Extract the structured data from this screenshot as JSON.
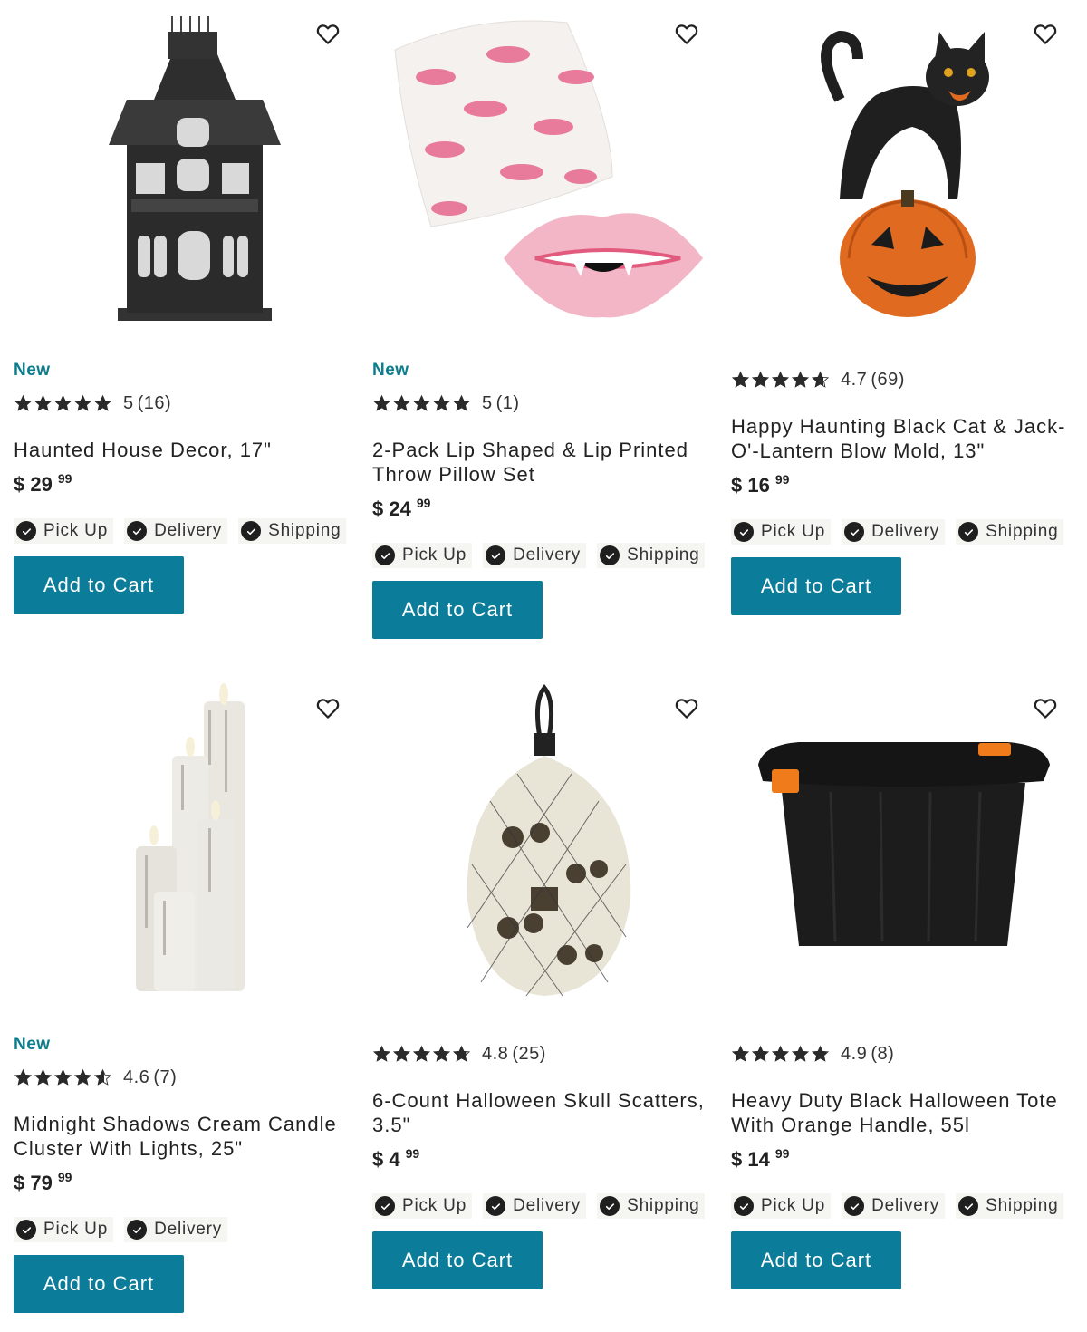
{
  "fulfillment_labels": {
    "pickup": "Pick Up",
    "delivery": "Delivery",
    "shipping": "Shipping"
  },
  "add_to_cart_label": "Add to Cart",
  "accent_colors": {
    "badge": "#0b7d8c",
    "button": "#0b7c99"
  },
  "products": [
    {
      "badge": "New",
      "rating": "5",
      "reviews": "(16)",
      "title": "Haunted House Decor, 17\"",
      "price_dollars": "$ 29",
      "price_cents": "99",
      "stars": 5,
      "fulfillment": [
        "pickup",
        "delivery",
        "shipping"
      ],
      "image": "haunted-house-image"
    },
    {
      "badge": "New",
      "rating": "5",
      "reviews": "(1)",
      "title": "2-Pack Lip Shaped & Lip Printed Throw Pillow Set",
      "price_dollars": "$ 24",
      "price_cents": "99",
      "stars": 5,
      "fulfillment": [
        "pickup",
        "delivery",
        "shipping"
      ],
      "image": "lip-pillow-image"
    },
    {
      "badge": "",
      "rating": "4.7",
      "reviews": "(69)",
      "title": "Happy Haunting Black Cat & Jack-O'-Lantern Blow Mold, 13\"",
      "price_dollars": "$ 16",
      "price_cents": "99",
      "stars": 4.7,
      "fulfillment": [
        "pickup",
        "delivery",
        "shipping"
      ],
      "image": "black-cat-pumpkin-image"
    },
    {
      "badge": "New",
      "rating": "4.6",
      "reviews": "(7)",
      "title": "Midnight Shadows Cream Candle Cluster With Lights, 25\"",
      "price_dollars": "$ 79",
      "price_cents": "99",
      "stars": 4.6,
      "fulfillment": [
        "pickup",
        "delivery"
      ],
      "image": "candle-cluster-image"
    },
    {
      "badge": "",
      "rating": "4.8",
      "reviews": "(25)",
      "title": "6-Count Halloween Skull Scatters, 3.5\"",
      "price_dollars": "$ 4",
      "price_cents": "99",
      "stars": 4.8,
      "fulfillment": [
        "pickup",
        "delivery",
        "shipping"
      ],
      "image": "skull-scatters-image"
    },
    {
      "badge": "",
      "rating": "4.9",
      "reviews": "(8)",
      "title": "Heavy Duty Black Halloween Tote With Orange Handle, 55l",
      "price_dollars": "$ 14",
      "price_cents": "99",
      "stars": 4.9,
      "fulfillment": [
        "pickup",
        "delivery",
        "shipping"
      ],
      "image": "storage-tote-image"
    }
  ]
}
